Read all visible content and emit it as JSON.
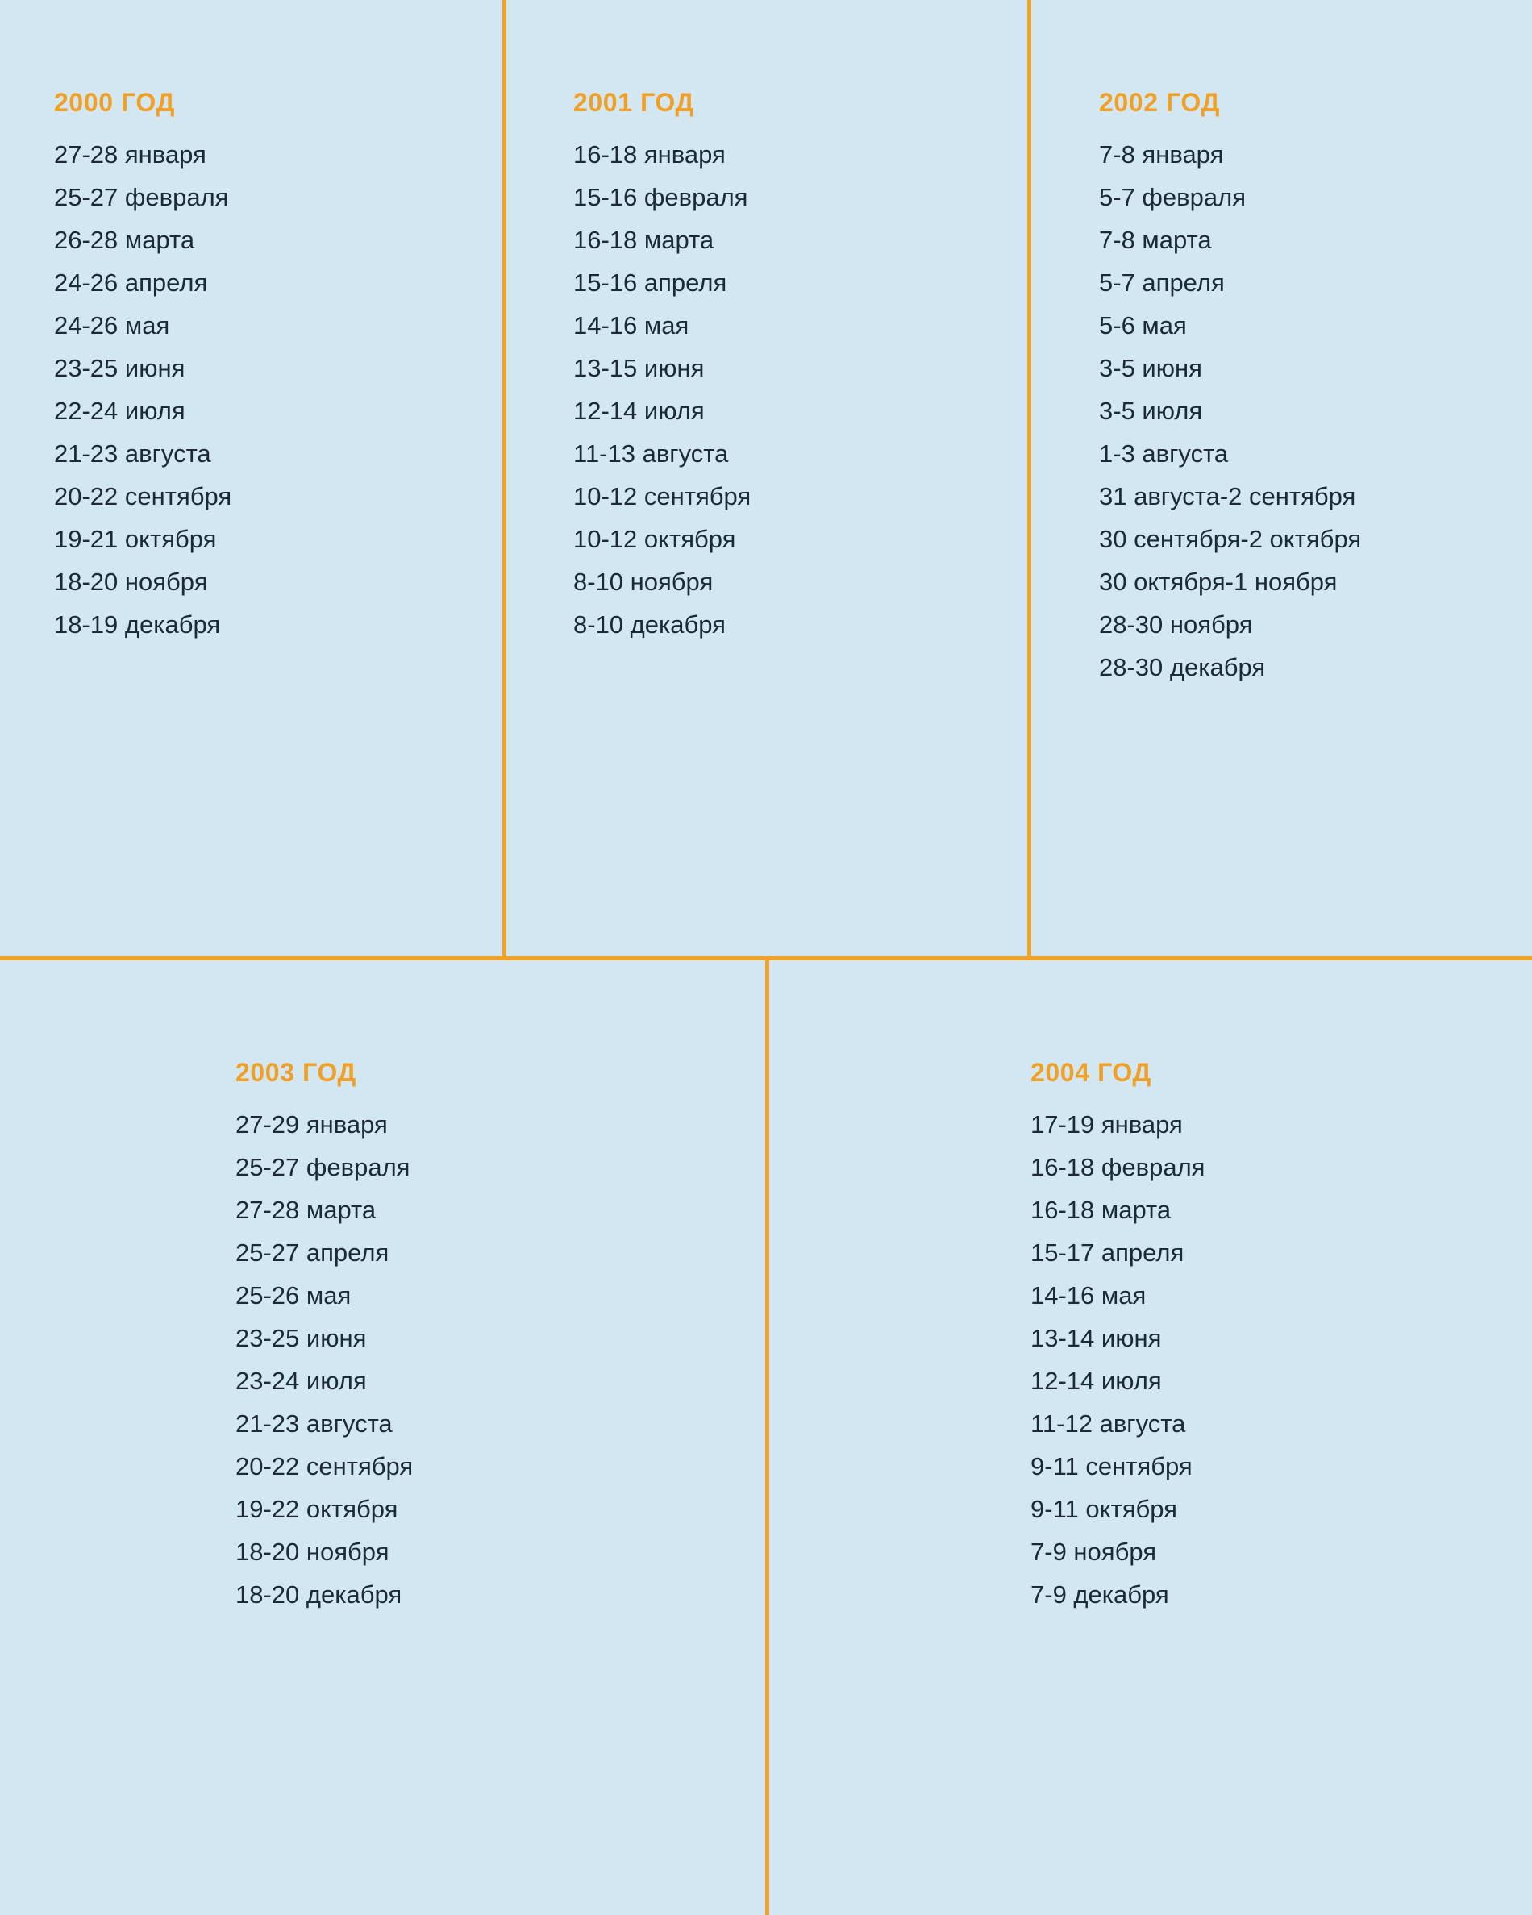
{
  "theme": {
    "background_color": "#D3E7F2",
    "accent_color": "#F0A026",
    "text_color": "#1B2A36",
    "divider_color": "#EDA22A"
  },
  "columns": [
    {
      "id": "year-2000",
      "heading": "2000 ГОД",
      "dates": [
        "27-28 января",
        "25-27 февраля",
        "26-28 марта",
        "24-26 апреля",
        "24-26 мая",
        "23-25 июня",
        "22-24 июля",
        "21-23 августа",
        "20-22 сентября",
        "19-21 октября",
        "18-20 ноября",
        "18-19 декабря"
      ]
    },
    {
      "id": "year-2001",
      "heading": "2001 ГОД",
      "dates": [
        "16-18 января",
        "15-16 февраля",
        "16-18 марта",
        "15-16 апреля",
        "14-16 мая",
        "13-15 июня",
        "12-14 июля",
        "11-13 августа",
        "10-12 сентября",
        "10-12 октября",
        "8-10 ноября",
        "8-10 декабря"
      ]
    },
    {
      "id": "year-2002",
      "heading": "2002 ГОД",
      "dates": [
        "7-8 января",
        "5-7 февраля",
        "7-8 марта",
        "5-7 апреля",
        "5-6 мая",
        "3-5 июня",
        "3-5 июля",
        "1-3 августа",
        "31 августа-2 сентября",
        "30 сентября-2 октября",
        "30 октября-1 ноября",
        "28-30 ноября",
        "28-30 декабря"
      ]
    },
    {
      "id": "year-2003",
      "heading": "2003 ГОД",
      "dates": [
        "27-29 января",
        "25-27 февраля",
        "27-28 марта",
        "25-27 апреля",
        "25-26 мая",
        "23-25 июня",
        "23-24 июля",
        "21-23 августа",
        "20-22 сентября",
        "19-22 октября",
        "18-20 ноября",
        "18-20 декабря"
      ]
    },
    {
      "id": "year-2004",
      "heading": "2004 ГОД",
      "dates": [
        "17-19 января",
        "16-18 февраля",
        "16-18 марта",
        "15-17 апреля",
        "14-16 мая",
        "13-14 июня",
        "12-14 июля",
        "11-12 августа",
        "9-11 сентября",
        "9-11 октября",
        "7-9 ноября",
        "7-9 декабря"
      ]
    }
  ]
}
